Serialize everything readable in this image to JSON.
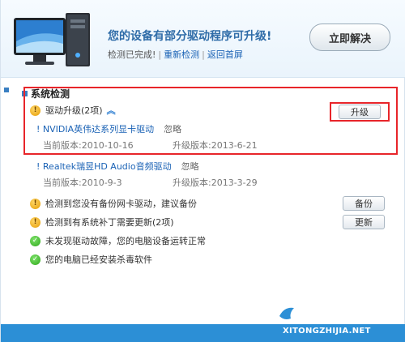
{
  "header": {
    "title": "您的设备有部分驱动程序可升级!",
    "status": "检测已完成!",
    "recheck_link": "重新检测",
    "home_link": "返回首屏",
    "solve_button": "立即解决"
  },
  "section": {
    "title": "系统检测"
  },
  "driver_upgrade": {
    "label": "驱动升级(2项)",
    "upgrade_button": "升级",
    "items": [
      {
        "name": "! NVIDIA英伟达系列显卡驱动",
        "ignore": "忽略",
        "current": "当前版本:2010-10-16",
        "upgrade": "升级版本:2013-6-21"
      },
      {
        "name": "! Realtek瑞昱HD Audio音频驱动",
        "ignore": "忽略",
        "current": "当前版本:2010-9-3",
        "upgrade": "升级版本:2013-3-29"
      }
    ]
  },
  "checks": [
    {
      "text": "检测到您没有备份网卡驱动，建议备份",
      "button": "备份",
      "icon": "warning-icon"
    },
    {
      "text": "检测到有系统补丁需要更新(2项)",
      "button": "更新",
      "icon": "warning-icon"
    },
    {
      "text": "未发现驱动故障，您的电脑设备运转正常",
      "icon": "check-icon"
    },
    {
      "text": "您的电脑已经安装杀毒软件",
      "icon": "check-icon"
    }
  ],
  "watermark": {
    "text": "XITONGZHIJIA.NET"
  },
  "colors": {
    "accent": "#2f6ca8",
    "link": "#1a62b5",
    "highlight": "#e8252a",
    "bottom_bar": "#2c8fd6"
  }
}
